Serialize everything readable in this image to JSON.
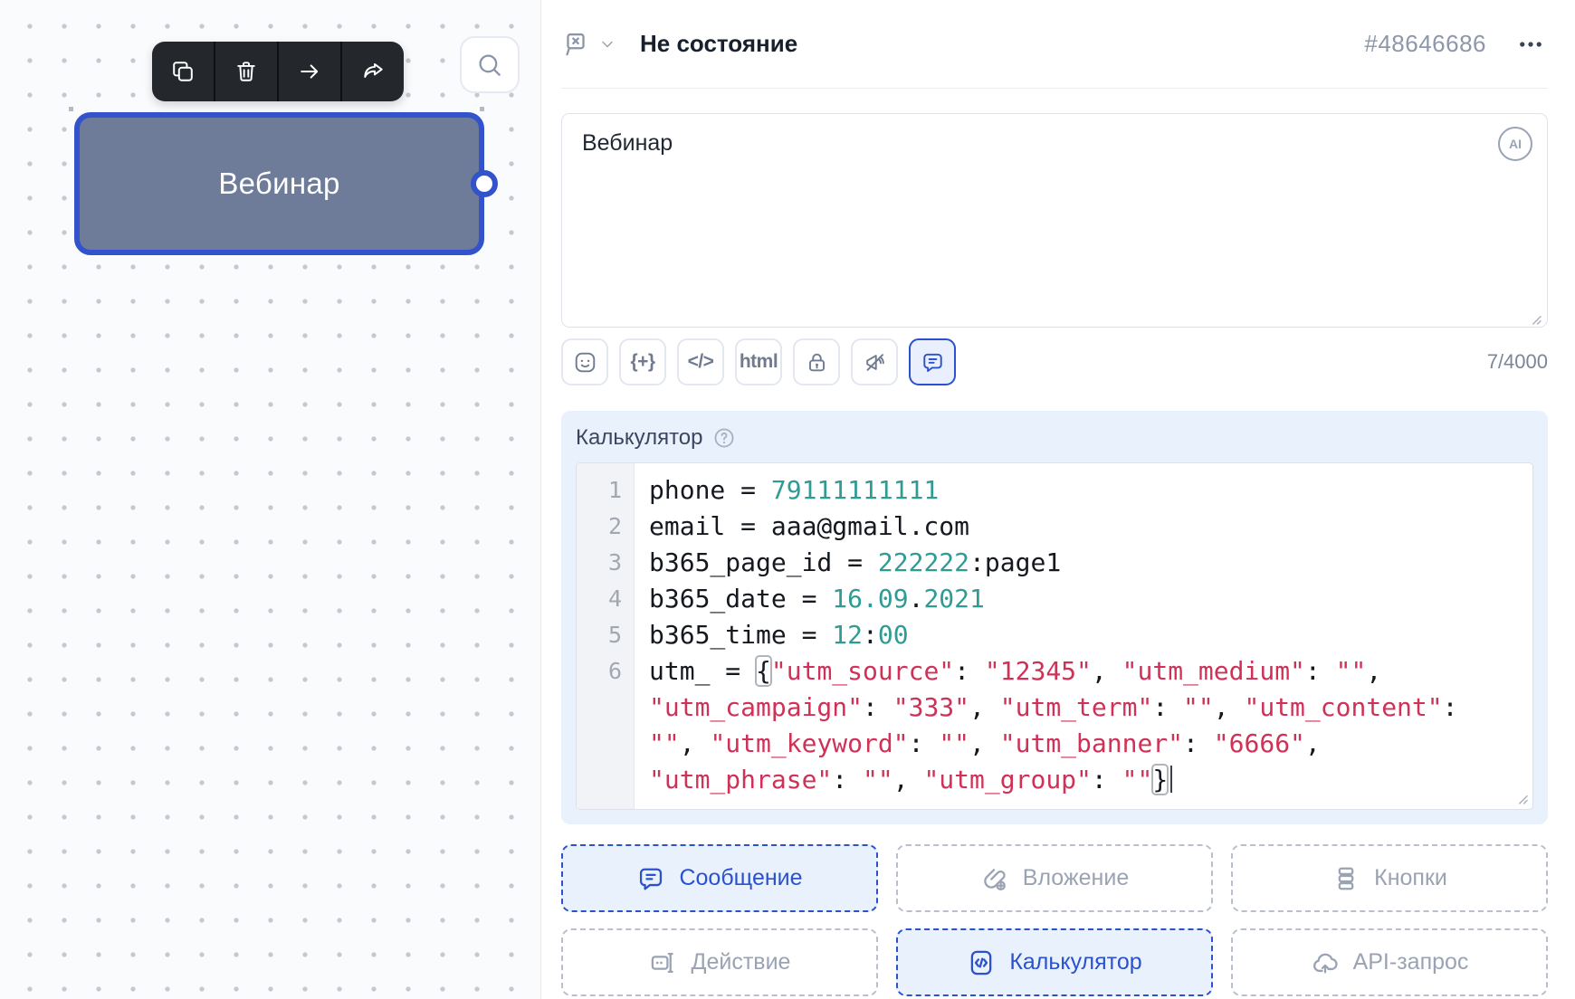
{
  "accent_color": "#2b51cf",
  "canvas": {
    "node": {
      "label": "Вебинар"
    },
    "node_toolbar": {
      "items": [
        {
          "name": "duplicate-node",
          "icon": "copy"
        },
        {
          "name": "delete-node",
          "icon": "trash"
        },
        {
          "name": "move-node",
          "icon": "arrow-right"
        },
        {
          "name": "share-node",
          "icon": "share"
        }
      ]
    },
    "search_button": {
      "icon": "search"
    }
  },
  "panel": {
    "header": {
      "title": "Не состояние",
      "node_id": "#48646686",
      "state_icon": "flag-x",
      "expand_icon": "chevron-down",
      "menu_icon": "dots"
    },
    "message_editor": {
      "text": "Вебинар",
      "ai_badge": "AI",
      "char_counter": "7/4000",
      "toolbar": [
        {
          "name": "emoji",
          "icon": "emoji",
          "active": false
        },
        {
          "name": "insert-variable",
          "label": "{+}",
          "active": false
        },
        {
          "name": "insert-code",
          "label": "</>",
          "active": false
        },
        {
          "name": "html-mode",
          "label": "html",
          "active": false
        },
        {
          "name": "lock",
          "icon": "lock",
          "active": false
        },
        {
          "name": "mute",
          "icon": "mute",
          "active": false
        },
        {
          "name": "comment",
          "icon": "comment",
          "active": true
        }
      ]
    },
    "calculator": {
      "label": "Калькулятор",
      "help_icon": "help",
      "code_rows": [
        {
          "num": "1",
          "segments": [
            {
              "t": "phone = ",
              "c": "plain"
            },
            {
              "t": "79111111111",
              "c": "num"
            }
          ]
        },
        {
          "num": "2",
          "segments": [
            {
              "t": "email = aaa@gmail.com",
              "c": "plain"
            }
          ]
        },
        {
          "num": "3",
          "segments": [
            {
              "t": "b365_page_id = ",
              "c": "plain"
            },
            {
              "t": "222222",
              "c": "num"
            },
            {
              "t": ":page1",
              "c": "plain"
            }
          ]
        },
        {
          "num": "4",
          "segments": [
            {
              "t": "b365_date = ",
              "c": "plain"
            },
            {
              "t": "16.09",
              "c": "num"
            },
            {
              "t": ".",
              "c": "plain"
            },
            {
              "t": "2021",
              "c": "num"
            }
          ]
        },
        {
          "num": "5",
          "segments": [
            {
              "t": "b365_time = ",
              "c": "plain"
            },
            {
              "t": "12",
              "c": "num"
            },
            {
              "t": ":",
              "c": "plain"
            },
            {
              "t": "00",
              "c": "num"
            }
          ]
        },
        {
          "num": "6",
          "segments": [
            {
              "t": "utm_ = ",
              "c": "plain"
            },
            {
              "t": "{",
              "c": "bracket"
            },
            {
              "t": "\"utm_source\"",
              "c": "str"
            },
            {
              "t": ": ",
              "c": "plain"
            },
            {
              "t": "\"12345\"",
              "c": "str"
            },
            {
              "t": ", ",
              "c": "plain"
            },
            {
              "t": "\"utm_medium\"",
              "c": "str"
            },
            {
              "t": ": ",
              "c": "plain"
            },
            {
              "t": "\"\"",
              "c": "str"
            },
            {
              "t": ",",
              "c": "plain"
            }
          ]
        },
        {
          "num": "",
          "segments": [
            {
              "t": "\"utm_campaign\"",
              "c": "str"
            },
            {
              "t": ": ",
              "c": "plain"
            },
            {
              "t": "\"333\"",
              "c": "str"
            },
            {
              "t": ", ",
              "c": "plain"
            },
            {
              "t": "\"utm_term\"",
              "c": "str"
            },
            {
              "t": ": ",
              "c": "plain"
            },
            {
              "t": "\"\"",
              "c": "str"
            },
            {
              "t": ", ",
              "c": "plain"
            },
            {
              "t": "\"utm_content\"",
              "c": "str"
            },
            {
              "t": ":",
              "c": "plain"
            }
          ]
        },
        {
          "num": "",
          "segments": [
            {
              "t": "\"\"",
              "c": "str"
            },
            {
              "t": ", ",
              "c": "plain"
            },
            {
              "t": "\"utm_keyword\"",
              "c": "str"
            },
            {
              "t": ": ",
              "c": "plain"
            },
            {
              "t": "\"\"",
              "c": "str"
            },
            {
              "t": ", ",
              "c": "plain"
            },
            {
              "t": "\"utm_banner\"",
              "c": "str"
            },
            {
              "t": ": ",
              "c": "plain"
            },
            {
              "t": "\"6666\"",
              "c": "str"
            },
            {
              "t": ",",
              "c": "plain"
            }
          ]
        },
        {
          "num": "",
          "segments": [
            {
              "t": "\"utm_phrase\"",
              "c": "str"
            },
            {
              "t": ": ",
              "c": "plain"
            },
            {
              "t": "\"\"",
              "c": "str"
            },
            {
              "t": ", ",
              "c": "plain"
            },
            {
              "t": "\"utm_group\"",
              "c": "str"
            },
            {
              "t": ": ",
              "c": "plain"
            },
            {
              "t": "\"\"",
              "c": "str"
            },
            {
              "t": "}",
              "c": "bracket"
            },
            {
              "t": "",
              "c": "cursor"
            }
          ]
        }
      ]
    },
    "blocks": [
      {
        "label": "Сообщение",
        "icon": "message",
        "active": true
      },
      {
        "label": "Вложение",
        "icon": "attachment",
        "active": false
      },
      {
        "label": "Кнопки",
        "icon": "buttons",
        "active": false
      },
      {
        "label": "Действие",
        "icon": "action",
        "active": false
      },
      {
        "label": "Калькулятор",
        "icon": "calculator",
        "active": true
      },
      {
        "label": "API-запрос",
        "icon": "api",
        "active": false
      }
    ]
  }
}
